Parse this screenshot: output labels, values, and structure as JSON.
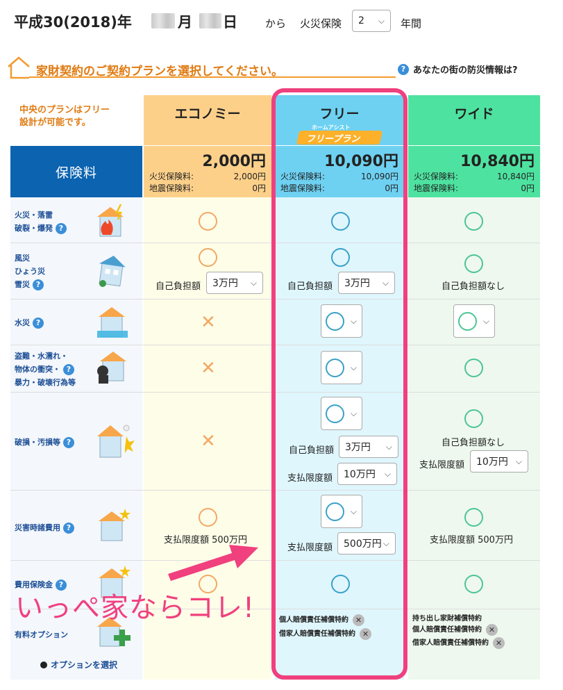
{
  "header": {
    "date_prefix": "平成30(2018)年",
    "month_suffix": "月",
    "day_suffix": "日",
    "from": "から",
    "insurance_label": "火災保険",
    "years_value": "2",
    "years_suffix": "年間"
  },
  "heading": {
    "title": "家財契約のご契約プランを選択してください。",
    "help_link": "あなたの街の防災情報は?"
  },
  "note": {
    "line1": "中央のプランはフリー",
    "line2": "設計が可能です。"
  },
  "premium_label": "保険料",
  "plans": {
    "economy": {
      "name": "エコノミー",
      "total": "2,000円",
      "fire_label": "火災保険料:",
      "fire_value": "2,000円",
      "quake_label": "地震保険料:",
      "quake_value": "0円"
    },
    "free": {
      "name": "フリー",
      "badge_small": "ホームアシスト",
      "badge_main": "フリープラン",
      "total": "10,090円",
      "fire_label": "火災保険料:",
      "fire_value": "10,090円",
      "quake_label": "地震保険料:",
      "quake_value": "0円"
    },
    "wide": {
      "name": "ワイド",
      "total": "10,840円",
      "fire_label": "火災保険料:",
      "fire_value": "10,840円",
      "quake_label": "地震保険料:",
      "quake_value": "0円"
    }
  },
  "rows": {
    "fire": {
      "line1": "火災・落雷",
      "line2": "破裂・爆発"
    },
    "wind": {
      "line1": "風災",
      "line2": "ひょう災",
      "line3": "雪災"
    },
    "water": {
      "line1": "水災"
    },
    "theft": {
      "line1": "盗難・水濡れ・",
      "line2": "物体の衝突・",
      "line3": "暴力・破壊行為等"
    },
    "damage": {
      "line1": "破損・汚損等"
    },
    "disaster": {
      "line1": "災害時諸費用"
    },
    "expense": {
      "line1": "費用保険金"
    },
    "options": {
      "line1": "有料オプション"
    }
  },
  "cells": {
    "deductible_label": "自己負担額",
    "deductible_value": "3万円",
    "no_deductible": "自己負担額なし",
    "limit_label": "支払限度額",
    "limit_10": "10万円",
    "limit_500": "500万円",
    "limit_500_text": "支払限度額 500万円"
  },
  "options": {
    "free": [
      "個人賠償責任補償特約",
      "借家人賠償責任補償特約"
    ],
    "wide": [
      "持ち出し家財補償特約",
      "個人賠償責任補償特約",
      "借家人賠償責任補償特約"
    ],
    "select_link": "オプションを選択"
  },
  "promo_text": "いっぺ家ならコレ!",
  "colors": {
    "economy_head": "#fdd08a",
    "free_head": "#6ed1f2",
    "wide_head": "#4ee2a0",
    "premium_label": "#0c63b0",
    "accent_orange": "#e07b12",
    "highlight_pink": "#f0407e"
  }
}
